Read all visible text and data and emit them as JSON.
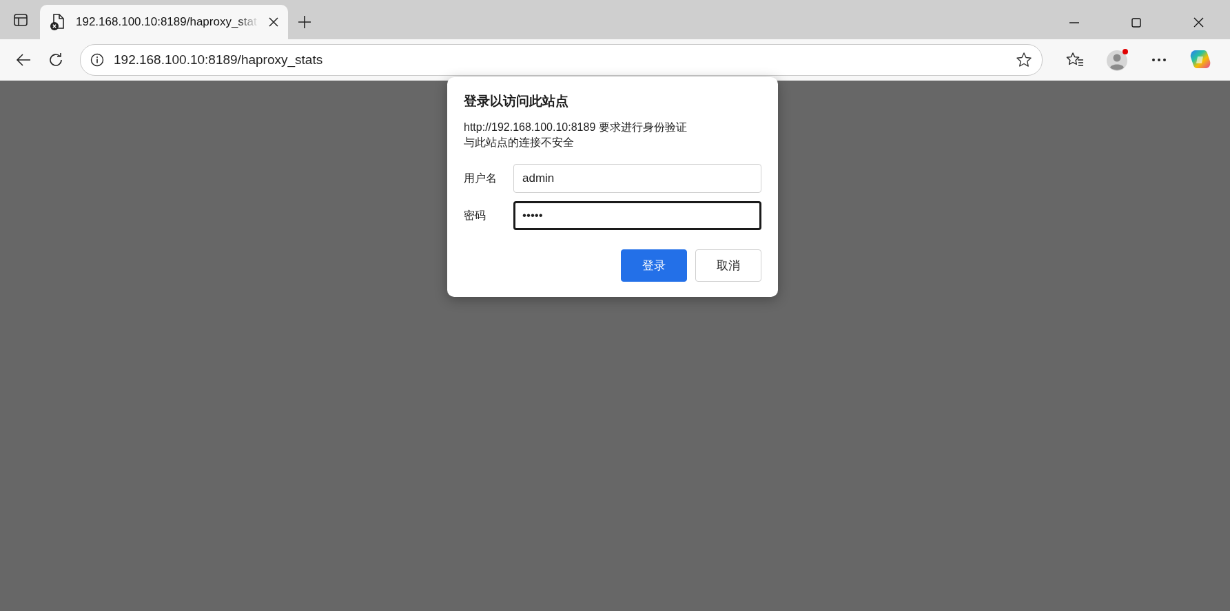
{
  "tab": {
    "title": "192.168.100.10:8189/haproxy_stat",
    "selected": true
  },
  "address_bar": {
    "url": "192.168.100.10:8189/haproxy_stats"
  },
  "dialog": {
    "title": "登录以访问此站点",
    "message_lines": [
      "http://192.168.100.10:8189 要求进行身份验证",
      "与此站点的连接不安全"
    ],
    "fields": [
      {
        "label": "用户名",
        "value": "admin",
        "focused": false
      },
      {
        "label": "密码",
        "value": "•••••",
        "focused": true
      }
    ],
    "buttons": [
      {
        "label": "登录",
        "kind": "primary"
      },
      {
        "label": "取消",
        "kind": "secondary"
      }
    ]
  }
}
